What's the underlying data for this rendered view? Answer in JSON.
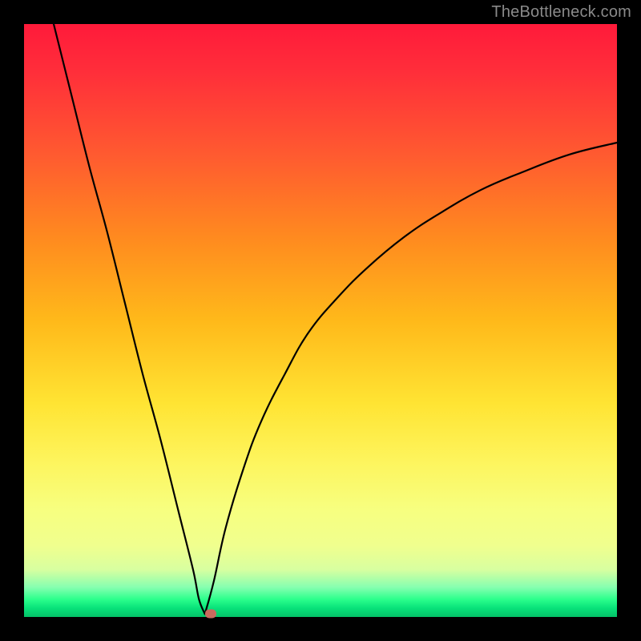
{
  "watermark": "TheBottleneck.com",
  "colors": {
    "frame": "#000000",
    "curve_stroke": "#000000",
    "marker_fill": "#c96a5e"
  },
  "chart_data": {
    "type": "line",
    "title": "",
    "xlabel": "",
    "ylabel": "",
    "xlim": [
      0,
      100
    ],
    "ylim": [
      0,
      100
    ],
    "grid": false,
    "legend": false,
    "optimum": {
      "x": 30.5,
      "y": 0.5
    },
    "marker": {
      "x": 31.5,
      "y": 0.5
    },
    "series": [
      {
        "name": "left-branch",
        "x": [
          5,
          8,
          11,
          14,
          17,
          20,
          23,
          26,
          28.5,
          29.5,
          30.5
        ],
        "values": [
          100,
          88,
          76,
          65,
          53,
          41,
          30,
          18,
          8,
          3,
          0.5
        ]
      },
      {
        "name": "right-branch",
        "x": [
          30.5,
          32,
          34,
          37,
          40,
          44,
          48,
          53,
          58,
          64,
          70,
          77,
          84,
          92,
          100
        ],
        "values": [
          0.5,
          6,
          15,
          25,
          33,
          41,
          48,
          54,
          59,
          64,
          68,
          72,
          75,
          78,
          80
        ]
      }
    ]
  }
}
